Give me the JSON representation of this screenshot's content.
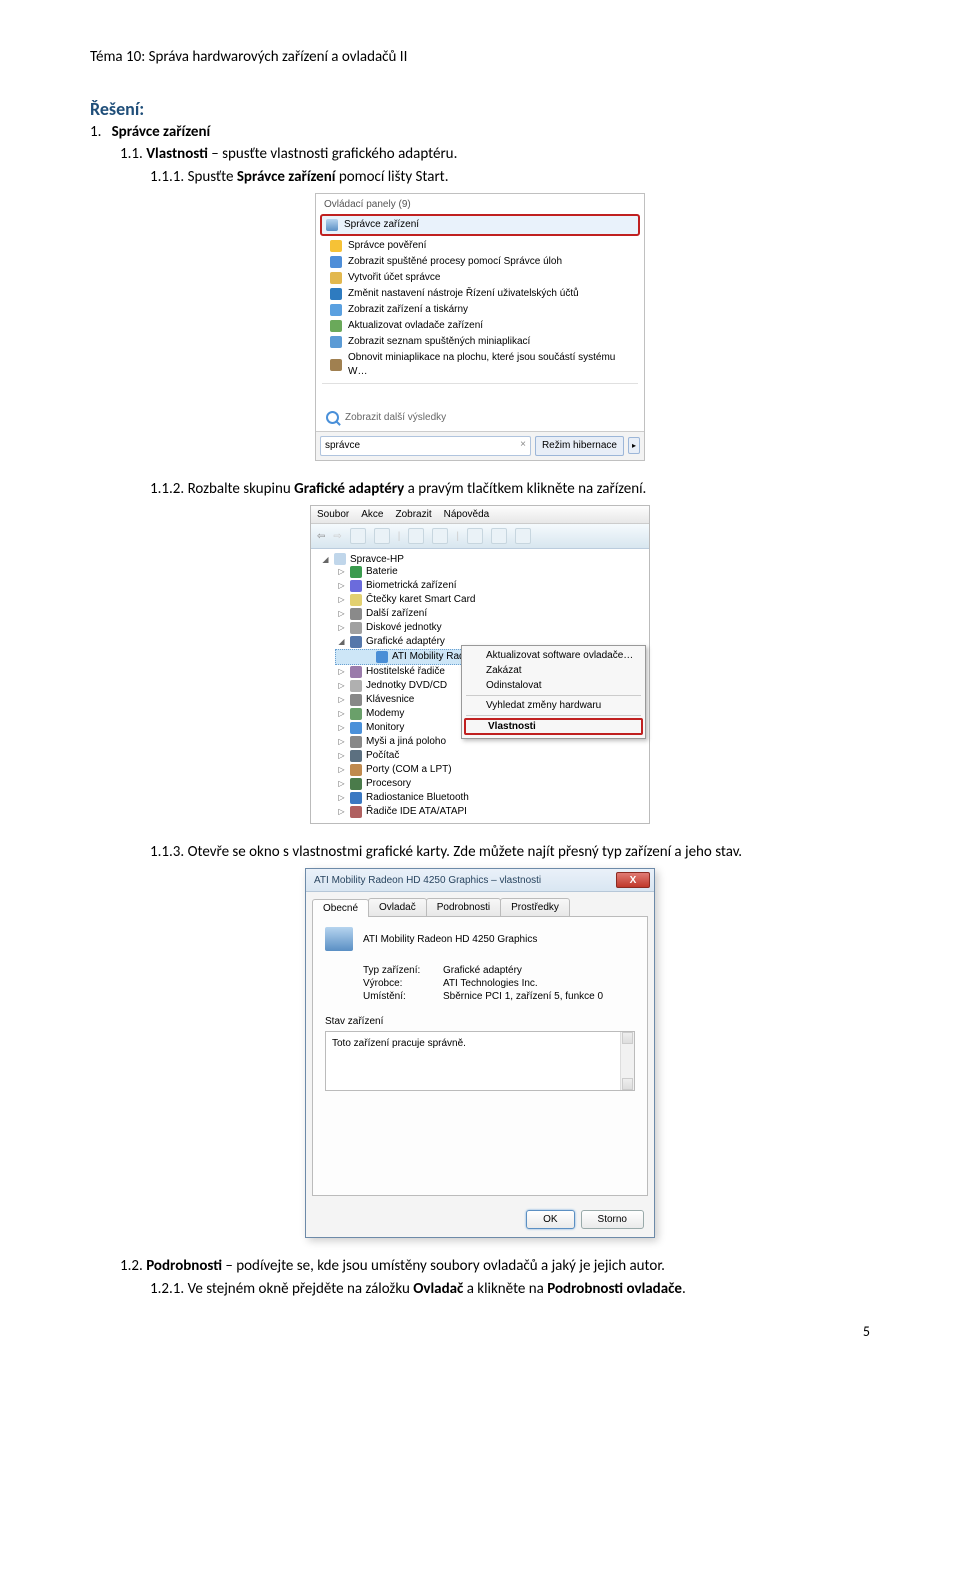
{
  "header": "Téma 10: Správa hardwarových zařízení a ovladačů II",
  "solution": {
    "heading": "Řešení:",
    "items": {
      "l1": {
        "num": "1.",
        "bold": "Správce zařízení"
      },
      "l11": {
        "num": "1.1.",
        "bold": "Vlastnosti",
        "rest": " – spusťte vlastnosti grafického adaptéru."
      },
      "l111": {
        "num": "1.1.1.",
        "text_a": "Spusťte ",
        "bold": "Správce zařízení",
        "text_b": " pomocí lišty Start."
      },
      "l112": {
        "num": "1.1.2.",
        "text_a": "Rozbalte skupinu ",
        "bold": "Grafické adaptéry",
        "text_b": " a pravým tlačítkem klikněte na zařízení."
      },
      "l113": {
        "num": "1.1.3.",
        "text": "Otevře se okno s vlastnostmi grafické karty. Zde můžete najít přesný typ zařízení a jeho stav."
      },
      "l12": {
        "num": "1.2.",
        "bold": "Podrobnosti",
        "rest": " – podívejte se, kde jsou umístěny soubory ovladačů a jaký je jejich autor."
      },
      "l121": {
        "num": "1.2.1.",
        "text_a": "Ve stejném okně přejděte na záložku ",
        "bold1": "Ovladač",
        "text_b": " a klikněte na ",
        "bold2": "Podrobnosti ovladače",
        "text_c": "."
      }
    }
  },
  "start": {
    "header": "Ovládací panely (9)",
    "highlight": "Správce zařízení",
    "rows": [
      {
        "icon": "#f6c236",
        "text": "Správce pověření"
      },
      {
        "icon": "#4e8ed8",
        "text": "Zobrazit spuštěné procesy pomocí Správce úloh"
      },
      {
        "icon": "#e2b84e",
        "text": "Vytvořit účet správce"
      },
      {
        "icon": "#2e7bc0",
        "text": "Změnit nastavení nástroje Řízení uživatelských účtů"
      },
      {
        "icon": "#5aa0e0",
        "text": "Zobrazit zařízení a tiskárny"
      },
      {
        "icon": "#6aa95a",
        "text": "Aktualizovat ovladače zařízení"
      },
      {
        "icon": "#5b9bd5",
        "text": "Zobrazit seznam spuštěných miniaplikací"
      },
      {
        "icon": "#a08050",
        "text": "Obnovit miniaplikace na plochu, které jsou součástí systému W…"
      }
    ],
    "more": "Zobrazit další výsledky",
    "search_value": "správce",
    "shutdown": "Režim hibernace"
  },
  "dm": {
    "menubar": [
      "Soubor",
      "Akce",
      "Zobrazit",
      "Nápověda"
    ],
    "root": "Spravce-HP",
    "tree": [
      {
        "icon": "#3a9b4e",
        "text": "Baterie"
      },
      {
        "icon": "#6b6bdc",
        "text": "Biometrická zařízení"
      },
      {
        "icon": "#e2d070",
        "text": "Čtečky karet Smart Card"
      },
      {
        "icon": "#8a8a8a",
        "text": "Další zařízení"
      },
      {
        "icon": "#a0a0a0",
        "text": "Diskové jednotky"
      },
      {
        "icon": "#5577aa",
        "text": "Grafické adaptéry",
        "expanded": true
      },
      {
        "icon": "#4a8ed6",
        "text": "ATI Mobility Radeon HD 4250 Graphics",
        "child": true,
        "selected": true
      },
      {
        "icon": "#9a7bab",
        "text": "Hostitelské řadiče"
      },
      {
        "icon": "#b0b0b0",
        "text": "Jednotky DVD/CD"
      },
      {
        "icon": "#888",
        "text": "Klávesnice"
      },
      {
        "icon": "#6aa06a",
        "text": "Modemy"
      },
      {
        "icon": "#4a90d9",
        "text": "Monitory"
      },
      {
        "icon": "#888",
        "text": "Myši a jiná poloho"
      },
      {
        "icon": "#5c7080",
        "text": "Počítač"
      },
      {
        "icon": "#c08a4e",
        "text": "Porty (COM a LPT)"
      },
      {
        "icon": "#4a7b4a",
        "text": "Procesory"
      },
      {
        "icon": "#3a78c2",
        "text": "Radiostanice Bluetooth"
      },
      {
        "icon": "#b06060",
        "text": "Řadiče IDE ATA/ATAPI"
      }
    ],
    "context": {
      "items": [
        "Aktualizovat software ovladače…",
        "Zakázat",
        "Odinstalovat"
      ],
      "item_sep1": "Vyhledat změny hardwaru",
      "item_hot": "Vlastnosti"
    }
  },
  "props": {
    "title": "ATI Mobility Radeon HD 4250 Graphics – vlastnosti",
    "tabs": [
      "Obecné",
      "Ovladač",
      "Podrobnosti",
      "Prostředky"
    ],
    "device_name": "ATI Mobility Radeon HD 4250 Graphics",
    "rows": [
      {
        "k": "Typ zařízení:",
        "v": "Grafické adaptéry"
      },
      {
        "k": "Výrobce:",
        "v": "ATI Technologies Inc."
      },
      {
        "k": "Umístění:",
        "v": "Sběrnice PCI 1, zařízení 5, funkce 0"
      }
    ],
    "status_label": "Stav zařízení",
    "status_text": "Toto zařízení pracuje správně.",
    "ok": "OK",
    "cancel": "Storno"
  },
  "page_number": "5"
}
